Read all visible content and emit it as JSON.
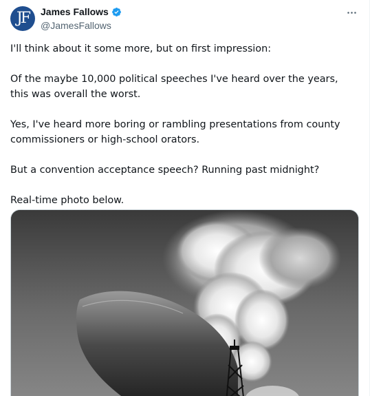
{
  "author": {
    "avatar_text": "JF",
    "display_name": "James Fallows",
    "handle": "@JamesFallows",
    "verified_color": "#1d9bf0",
    "avatar_color": "#1f4e8f"
  },
  "tweet": {
    "paragraphs": [
      "I'll think about it some more, but on first impression:",
      "Of the maybe 10,000 political speeches I've heard over the years, this was overall the worst.",
      "Yes, I've heard more boring or rambling presentations from county commissioners or high-school orators.",
      "But a convention acceptance speech? Running past midnight?",
      "Real-time photo below."
    ]
  },
  "media": {
    "description_icon": "photo-icon"
  },
  "menu": {
    "icon": "more-horizontal-icon"
  }
}
